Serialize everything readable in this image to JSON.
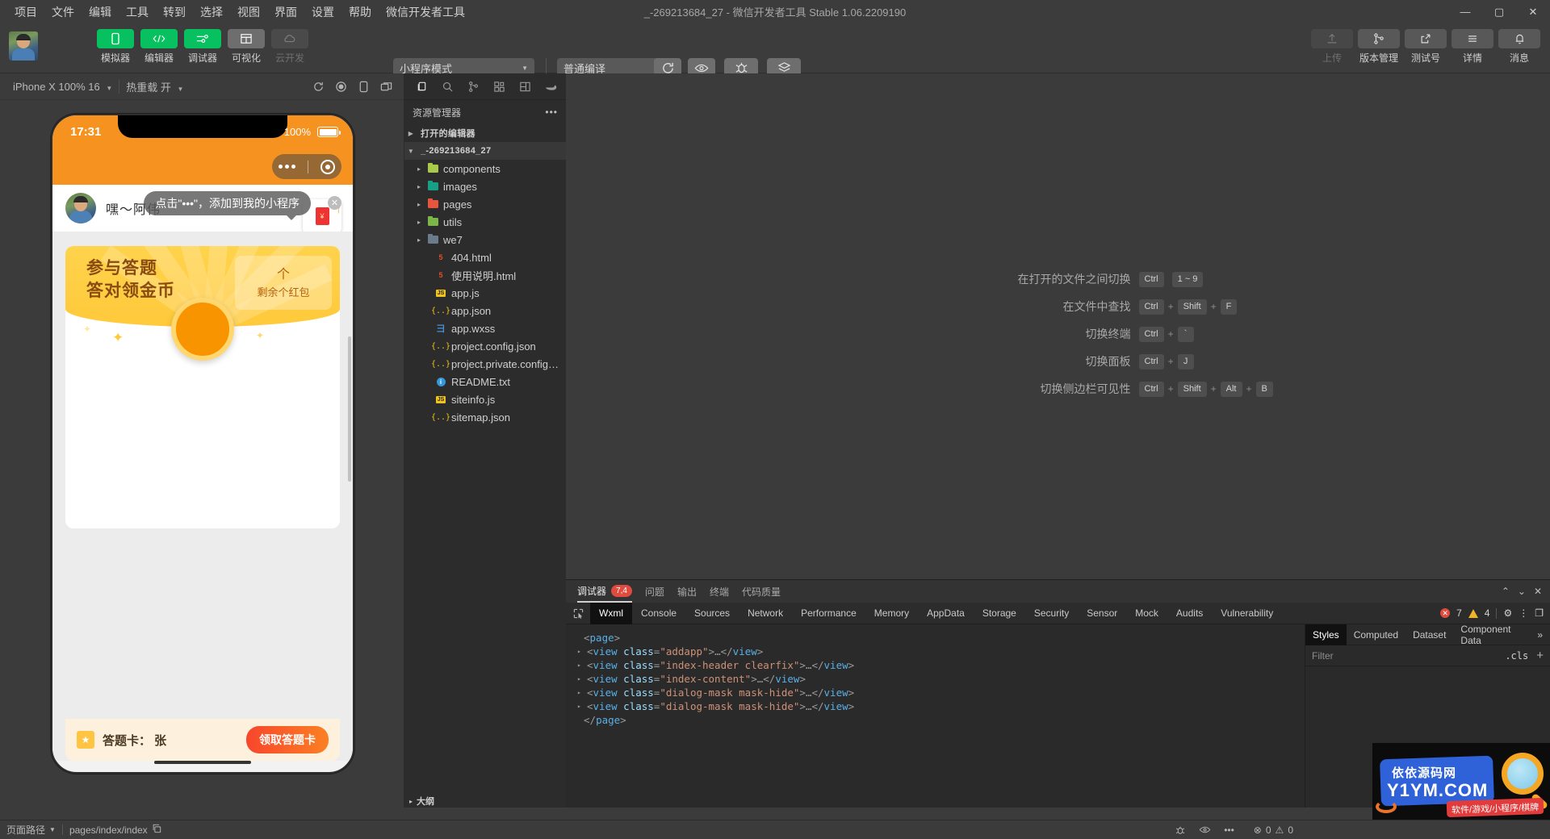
{
  "window": {
    "title": "_-269213684_27 - 微信开发者工具 Stable 1.06.2209190",
    "minimize": "—",
    "maximize": "▢",
    "close": "✕"
  },
  "menubar": [
    "项目",
    "文件",
    "编辑",
    "工具",
    "转到",
    "选择",
    "视图",
    "界面",
    "设置",
    "帮助",
    "微信开发者工具"
  ],
  "toolbar": {
    "mode_buttons": [
      {
        "label": "模拟器",
        "icon": "phone-icon",
        "state": "active"
      },
      {
        "label": "编辑器",
        "icon": "code-icon",
        "state": "active"
      },
      {
        "label": "调试器",
        "icon": "sliders-icon",
        "state": "active"
      },
      {
        "label": "可视化",
        "icon": "layout-icon",
        "state": "inactive"
      },
      {
        "label": "云开发",
        "icon": "cloud-icon",
        "state": "disabled"
      }
    ],
    "mode_select": "小程序模式",
    "compile_select": "普通编译",
    "actions": [
      {
        "label": "编译",
        "icon": "refresh-icon"
      },
      {
        "label": "预览",
        "icon": "eye-icon"
      },
      {
        "label": "真机调试",
        "icon": "bug-icon"
      },
      {
        "label": "清缓存",
        "icon": "stack-icon"
      }
    ],
    "right_buttons": [
      {
        "label": "上传",
        "icon": "upload-icon",
        "state": "disabled"
      },
      {
        "label": "版本管理",
        "icon": "branch-icon",
        "state": "normal"
      },
      {
        "label": "测试号",
        "icon": "external-link-icon",
        "state": "normal"
      },
      {
        "label": "详情",
        "icon": "menu-icon",
        "state": "normal"
      },
      {
        "label": "消息",
        "icon": "bell-icon",
        "state": "normal"
      }
    ]
  },
  "simulator": {
    "device": "iPhone X 100% 16",
    "hot_reload": "热重载 开",
    "icons": [
      "refresh-icon",
      "record-icon",
      "rotate-device-icon",
      "multi-window-icon"
    ],
    "phone": {
      "status_time": "17:31",
      "battery_text": "100%",
      "user_name": "嘿～阿伟",
      "tip_text": "点击\"•••\"，添加到我的小程序",
      "tip_close": "✕",
      "banner_line1": "参与答题",
      "banner_line2": "答对领金币",
      "badge_count": "个",
      "badge_label": "剩余个红包",
      "footer_label": "答题卡： 张",
      "footer_button": "领取答题卡"
    }
  },
  "explorer": {
    "title": "资源管理器",
    "more": "•••",
    "action_icons": [
      "files-icon",
      "search-icon",
      "source-control-icon",
      "extensions-icon",
      "layout-icon",
      "cloud-debug-icon"
    ],
    "sections": [
      {
        "label": "打开的编辑器",
        "expanded": false,
        "indent": 0,
        "type": "section"
      },
      {
        "label": "_-269213684_27",
        "expanded": true,
        "indent": 0,
        "type": "section",
        "selected": true
      }
    ],
    "items": [
      {
        "label": "components",
        "type": "folder",
        "color": "#a8c94a",
        "indent": 1,
        "twisty": "▸"
      },
      {
        "label": "images",
        "type": "folder",
        "color": "#16a085",
        "indent": 1,
        "twisty": "▸"
      },
      {
        "label": "pages",
        "type": "folder",
        "color": "#e8553e",
        "indent": 1,
        "twisty": "▸"
      },
      {
        "label": "utils",
        "type": "folder",
        "color": "#7ab648",
        "indent": 1,
        "twisty": "▸"
      },
      {
        "label": "we7",
        "type": "folder",
        "color": "#6b7b8c",
        "indent": 1,
        "twisty": "▸"
      },
      {
        "label": "404.html",
        "type": "html",
        "color": "#e44d26",
        "indent": 2,
        "twisty": ""
      },
      {
        "label": "使用说明.html",
        "type": "html",
        "color": "#e44d26",
        "indent": 2,
        "twisty": ""
      },
      {
        "label": "app.js",
        "type": "js",
        "color": "#f0c419",
        "indent": 2,
        "twisty": ""
      },
      {
        "label": "app.json",
        "type": "json",
        "color": "#f0c419",
        "indent": 2,
        "twisty": ""
      },
      {
        "label": "app.wxss",
        "type": "wxss",
        "color": "#4a90d9",
        "indent": 2,
        "twisty": ""
      },
      {
        "label": "project.config.json",
        "type": "json",
        "color": "#f0c419",
        "indent": 2,
        "twisty": ""
      },
      {
        "label": "project.private.config.js...",
        "type": "json",
        "color": "#f0c419",
        "indent": 2,
        "twisty": ""
      },
      {
        "label": "README.txt",
        "type": "info",
        "color": "#3498db",
        "indent": 2,
        "twisty": ""
      },
      {
        "label": "siteinfo.js",
        "type": "js",
        "color": "#f0c419",
        "indent": 2,
        "twisty": ""
      },
      {
        "label": "sitemap.json",
        "type": "json",
        "color": "#f0c419",
        "indent": 2,
        "twisty": ""
      }
    ],
    "outline": "大纲"
  },
  "editor": {
    "shortcuts": [
      {
        "label": "在打开的文件之间切换",
        "keys": [
          "Ctrl",
          "1 ~ 9"
        ],
        "seps": [
          ""
        ]
      },
      {
        "label": "在文件中查找",
        "keys": [
          "Ctrl",
          "Shift",
          "F"
        ],
        "seps": [
          "+",
          "+"
        ]
      },
      {
        "label": "切换终端",
        "keys": [
          "Ctrl",
          "`"
        ],
        "seps": [
          "+"
        ]
      },
      {
        "label": "切换面板",
        "keys": [
          "Ctrl",
          "J"
        ],
        "seps": [
          "+"
        ]
      },
      {
        "label": "切换侧边栏可见性",
        "keys": [
          "Ctrl",
          "Shift",
          "Alt",
          "B"
        ],
        "seps": [
          "+",
          "+",
          "+"
        ]
      }
    ]
  },
  "debugger": {
    "panel_tabs": [
      {
        "label": "调试器",
        "badge": "7,4",
        "active": true
      },
      {
        "label": "问题",
        "badge": "",
        "active": false
      },
      {
        "label": "输出",
        "badge": "",
        "active": false
      },
      {
        "label": "终端",
        "badge": "",
        "active": false
      },
      {
        "label": "代码质量",
        "badge": "",
        "active": false
      }
    ],
    "panel_controls": [
      "chevron-up-icon",
      "chevron-down-icon",
      "close-icon"
    ],
    "devtool_tabs": [
      "Wxml",
      "Console",
      "Sources",
      "Network",
      "Performance",
      "Memory",
      "AppData",
      "Storage",
      "Security",
      "Sensor",
      "Mock",
      "Audits",
      "Vulnerability"
    ],
    "active_devtool_tab": "Wxml",
    "error_count": "7",
    "warning_count": "4",
    "wxml": [
      {
        "indent": 0,
        "twisty": "",
        "parts": [
          {
            "t": "pun",
            "v": "<"
          },
          {
            "t": "tag",
            "v": "page"
          },
          {
            "t": "pun",
            "v": ">"
          }
        ]
      },
      {
        "indent": 1,
        "twisty": "▸",
        "parts": [
          {
            "t": "pun",
            "v": "<"
          },
          {
            "t": "tag",
            "v": "view"
          },
          {
            "t": "attr",
            "v": " class"
          },
          {
            "t": "pun",
            "v": "="
          },
          {
            "t": "val",
            "v": "\"addapp\""
          },
          {
            "t": "pun",
            "v": ">…</"
          },
          {
            "t": "tag",
            "v": "view"
          },
          {
            "t": "pun",
            "v": ">"
          }
        ]
      },
      {
        "indent": 1,
        "twisty": "▸",
        "parts": [
          {
            "t": "pun",
            "v": "<"
          },
          {
            "t": "tag",
            "v": "view"
          },
          {
            "t": "attr",
            "v": " class"
          },
          {
            "t": "pun",
            "v": "="
          },
          {
            "t": "val",
            "v": "\"index-header clearfix\""
          },
          {
            "t": "pun",
            "v": ">…</"
          },
          {
            "t": "tag",
            "v": "view"
          },
          {
            "t": "pun",
            "v": ">"
          }
        ]
      },
      {
        "indent": 1,
        "twisty": "▸",
        "parts": [
          {
            "t": "pun",
            "v": "<"
          },
          {
            "t": "tag",
            "v": "view"
          },
          {
            "t": "attr",
            "v": " class"
          },
          {
            "t": "pun",
            "v": "="
          },
          {
            "t": "val",
            "v": "\"index-content\""
          },
          {
            "t": "pun",
            "v": ">…</"
          },
          {
            "t": "tag",
            "v": "view"
          },
          {
            "t": "pun",
            "v": ">"
          }
        ]
      },
      {
        "indent": 1,
        "twisty": "▸",
        "parts": [
          {
            "t": "pun",
            "v": "<"
          },
          {
            "t": "tag",
            "v": "view"
          },
          {
            "t": "attr",
            "v": " class"
          },
          {
            "t": "pun",
            "v": "="
          },
          {
            "t": "val",
            "v": "\"dialog-mask mask-hide\""
          },
          {
            "t": "pun",
            "v": ">…</"
          },
          {
            "t": "tag",
            "v": "view"
          },
          {
            "t": "pun",
            "v": ">"
          }
        ]
      },
      {
        "indent": 1,
        "twisty": "▸",
        "parts": [
          {
            "t": "pun",
            "v": "<"
          },
          {
            "t": "tag",
            "v": "view"
          },
          {
            "t": "attr",
            "v": " class"
          },
          {
            "t": "pun",
            "v": "="
          },
          {
            "t": "val",
            "v": "\"dialog-mask mask-hide\""
          },
          {
            "t": "pun",
            "v": ">…</"
          },
          {
            "t": "tag",
            "v": "view"
          },
          {
            "t": "pun",
            "v": ">"
          }
        ]
      },
      {
        "indent": 0,
        "twisty": "",
        "parts": [
          {
            "t": "pun",
            "v": "</"
          },
          {
            "t": "tag",
            "v": "page"
          },
          {
            "t": "pun",
            "v": ">"
          }
        ]
      }
    ],
    "styles": {
      "tabs": [
        "Styles",
        "Computed",
        "Dataset",
        "Component Data"
      ],
      "active_tab": "Styles",
      "overflow": "»",
      "filter_placeholder": "Filter",
      "cls_label": ".cls",
      "add_label": "+"
    }
  },
  "statusbar": {
    "page_path_label": "页面路径",
    "page_path_value": "pages/index/index",
    "copy_icon": "copy-icon",
    "right_icons": [
      "bug-icon",
      "eye-icon",
      "more-icon"
    ],
    "problems_errors": "0",
    "problems_warnings": "0"
  },
  "watermark": {
    "brand_cn": "依依源码网",
    "brand_en": "Y1YM.COM",
    "tagline": "软件/游戏/小程序/棋牌"
  },
  "colors": {
    "accent_green": "#07c160",
    "orange": "#f59220",
    "error_red": "#e04b3f",
    "warning_yellow": "#f0b429"
  }
}
